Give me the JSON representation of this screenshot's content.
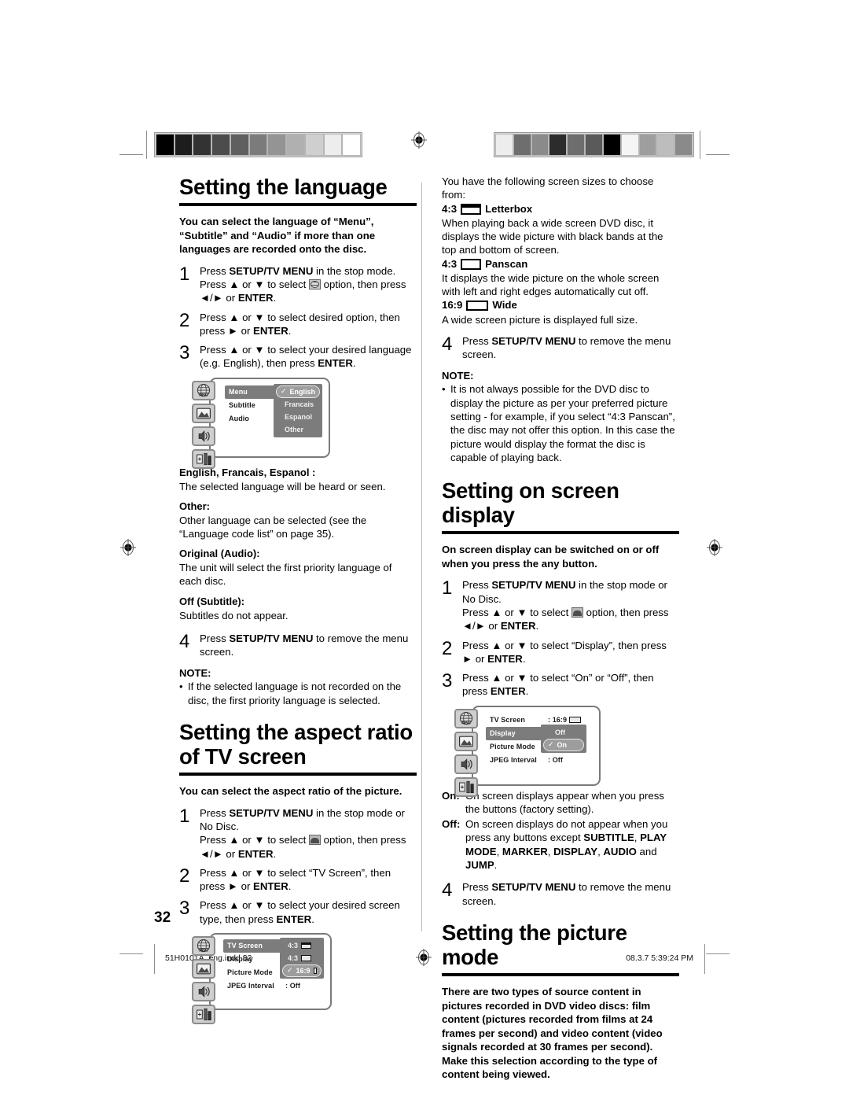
{
  "document": {
    "page_number": "32",
    "footer_left": "51H0101A_eng.indd   32",
    "footer_right": "08.3.7   5:39:24 PM"
  },
  "calibration": {
    "left_bar": [
      "#000000",
      "#1d1d1d",
      "#333333",
      "#4c4c4c",
      "#5f5f5f",
      "#7b7b7b",
      "#949494",
      "#b0b0b0",
      "#cfcfcf",
      "#ededed",
      "#ffffff"
    ],
    "right_bar": [
      "#ededed",
      "#6e6e6e",
      "#8a8a8a",
      "#2c2c2c",
      "#6e6e6e",
      "#5a5a5a",
      "#000000",
      "#f5f5f5",
      "#9e9e9e",
      "#bdbdbd",
      "#8a8a8a"
    ]
  },
  "left_column": {
    "section_language": {
      "title": "Setting the language",
      "lead": "You can select the language of “Menu”, “Subtitle” and “Audio” if more than one languages are recorded onto the disc.",
      "steps": [
        {
          "num": "1",
          "line1_a": "Press ",
          "line1_b": "SETUP/TV MENU",
          "line1_c": " in the stop mode.",
          "line2_a": "Press ▲ or ▼ to select ",
          "line2_icon": "globe-icon",
          "line2_b": " option, then press ◄/► or ",
          "line2_c": "ENTER",
          "line2_d": "."
        },
        {
          "num": "2",
          "line1_a": "Press ▲ or ▼ to select desired option, then press ► or ",
          "line1_b": "ENTER",
          "line1_c": "."
        },
        {
          "num": "3",
          "line1_a": "Press ▲ or ▼ to select your desired language (e.g. English), then press ",
          "line1_b": "ENTER",
          "line1_c": "."
        }
      ],
      "osd": {
        "rows": [
          {
            "label": "Menu",
            "selected": true
          },
          {
            "label": "Subtitle",
            "selected": false
          },
          {
            "label": "Audio",
            "selected": false
          }
        ],
        "popup": [
          {
            "label": "English",
            "checked": true
          },
          {
            "label": "Francais",
            "checked": false
          },
          {
            "label": "Espanol",
            "checked": false
          },
          {
            "label": "Other",
            "checked": false
          }
        ],
        "rail_icons": [
          "globe-icon",
          "tv-picture-icon",
          "audio-icon",
          "settings-icon"
        ]
      },
      "definitions": [
        {
          "term": "English, Francais, Espanol :",
          "desc": "The selected language will be heard or seen."
        },
        {
          "term": "Other:",
          "desc": "Other language can be selected (see the “Language code list” on page 35)."
        },
        {
          "term": "Original (Audio):",
          "desc": "The unit will select the first priority language of each disc."
        },
        {
          "term": "Off (Subtitle):",
          "desc": "Subtitles do not appear."
        }
      ],
      "step4": {
        "num": "4",
        "a": "Press ",
        "b": "SETUP/TV MENU",
        "c": " to remove the menu screen."
      },
      "note_heading": "NOTE:",
      "note_item": "If the selected language is not recorded on the disc, the first priority language is selected."
    },
    "section_aspect": {
      "title": "Setting the aspect ratio of TV screen",
      "lead": "You can select the aspect ratio of the picture.",
      "steps": [
        {
          "num": "1",
          "line1_a": "Press ",
          "line1_b": "SETUP/TV MENU",
          "line1_c": " in the stop mode or No Disc.",
          "line2_a": "Press ▲ or ▼ to select ",
          "line2_icon": "tv-picture-icon",
          "line2_b": " option, then press ◄/► or ",
          "line2_c": "ENTER",
          "line2_d": "."
        },
        {
          "num": "2",
          "line1_a": "Press ▲ or ▼ to select “TV Screen”, then press ► or ",
          "line1_b": "ENTER",
          "line1_c": "."
        },
        {
          "num": "3",
          "line1_a": "Press ▲ or ▼ to select your desired screen type, then press ",
          "line1_b": "ENTER",
          "line1_c": "."
        }
      ],
      "osd": {
        "rows": [
          {
            "label": "TV Screen",
            "value": "4:3",
            "icon": "ratio-43-letterbox-icon",
            "selected": true
          },
          {
            "label": "Display",
            "value": "",
            "icon": "",
            "selected": false
          },
          {
            "label": "Picture Mode",
            "value": "",
            "icon": "",
            "selected": false
          },
          {
            "label": "JPEG Interval",
            "value": ": Off",
            "icon": "",
            "selected": false
          }
        ],
        "popup": [
          {
            "label": "4:3",
            "icon": "ratio-43-letterbox-icon",
            "checked": false
          },
          {
            "label": "4:3",
            "icon": "ratio-43-panscan-icon",
            "checked": false
          },
          {
            "label": "16:9",
            "icon": "ratio-169-wide-icon",
            "checked": true
          }
        ],
        "rail_icons": [
          "globe-icon",
          "tv-picture-icon",
          "audio-icon",
          "settings-icon"
        ]
      }
    }
  },
  "right_column": {
    "aspect_continued": {
      "intro": "You have the following screen sizes to choose from:",
      "modes": [
        {
          "ratio": "4:3",
          "icon": "ratio-43-letterbox-icon",
          "name": "Letterbox",
          "desc": "When playing back a wide screen DVD disc, it displays the wide picture with black bands at the top and bottom of screen."
        },
        {
          "ratio": "4:3",
          "icon": "ratio-43-panscan-icon",
          "name": "Panscan",
          "desc": "It displays the wide picture on the whole screen with left and right edges automatically cut off."
        },
        {
          "ratio": "16:9",
          "icon": "ratio-169-wide-icon",
          "name": "Wide",
          "desc": "A wide screen picture is displayed full size."
        }
      ],
      "step4": {
        "num": "4",
        "a": "Press ",
        "b": "SETUP/TV MENU",
        "c": " to remove the menu screen."
      },
      "note_heading": "NOTE:",
      "note_item": "It is not always possible for the DVD disc to display the picture as per your preferred picture setting - for example, if you select “4:3 Panscan”, the disc may not offer this option. In this case the picture would display the format the disc is capable of playing back."
    },
    "section_osd": {
      "title": "Setting on screen display",
      "lead": "On screen display can be switched on or off when you press the any button.",
      "steps": [
        {
          "num": "1",
          "line1_a": "Press ",
          "line1_b": "SETUP/TV MENU",
          "line1_c": " in the stop mode or No Disc.",
          "line2_a": "Press ▲ or ▼ to select ",
          "line2_icon": "tv-picture-icon",
          "line2_b": " option, then press ◄/► or ",
          "line2_c": "ENTER",
          "line2_d": "."
        },
        {
          "num": "2",
          "line1_a": "Press ▲ or ▼ to select “Display”, then press ► or ",
          "line1_b": "ENTER",
          "line1_c": "."
        },
        {
          "num": "3",
          "line1_a": "Press ▲ or ▼ to select “On” or “Off”, then press ",
          "line1_b": "ENTER",
          "line1_c": "."
        }
      ],
      "osd": {
        "rows": [
          {
            "label": "TV Screen",
            "value": ": 16:9",
            "icon": "ratio-169-wide-icon",
            "selected": false
          },
          {
            "label": "Display",
            "value": "",
            "icon": "",
            "selected": true
          },
          {
            "label": "Picture Mode",
            "value": "",
            "icon": "",
            "selected": false
          },
          {
            "label": "JPEG Interval",
            "value": ": Off",
            "icon": "",
            "selected": false
          }
        ],
        "popup": [
          {
            "label": "Off",
            "checked": false
          },
          {
            "label": "On",
            "checked": true
          }
        ],
        "rail_icons": [
          "globe-icon",
          "tv-picture-icon",
          "audio-icon",
          "settings-icon"
        ]
      },
      "on_key": "On:",
      "on_val": "On screen displays appear when you press the buttons (factory setting).",
      "off_key": "Off:",
      "off_val_1": "On screen displays do not appear when you press any buttons except ",
      "off_val_bold_1": "SUBTITLE",
      "off_val_2": ", ",
      "off_val_bold_2": "PLAY MODE",
      "off_val_3": ", ",
      "off_val_bold_3": "MARKER",
      "off_val_4": ", ",
      "off_val_bold_4": "DISPLAY",
      "off_val_5": ", ",
      "off_val_bold_5": "AUDIO",
      "off_val_6": " and ",
      "off_val_bold_6": "JUMP",
      "off_val_7": ".",
      "step4": {
        "num": "4",
        "a": "Press ",
        "b": "SETUP/TV MENU",
        "c": " to remove the menu screen."
      }
    },
    "section_picture_mode": {
      "title": "Setting the picture mode",
      "lead": "There are two types of source content in pictures recorded in DVD video discs: film content (pictures recorded from films at 24 frames per second) and video content (video signals recorded at 30 frames per second). Make this selection according to the type of content being viewed."
    }
  }
}
